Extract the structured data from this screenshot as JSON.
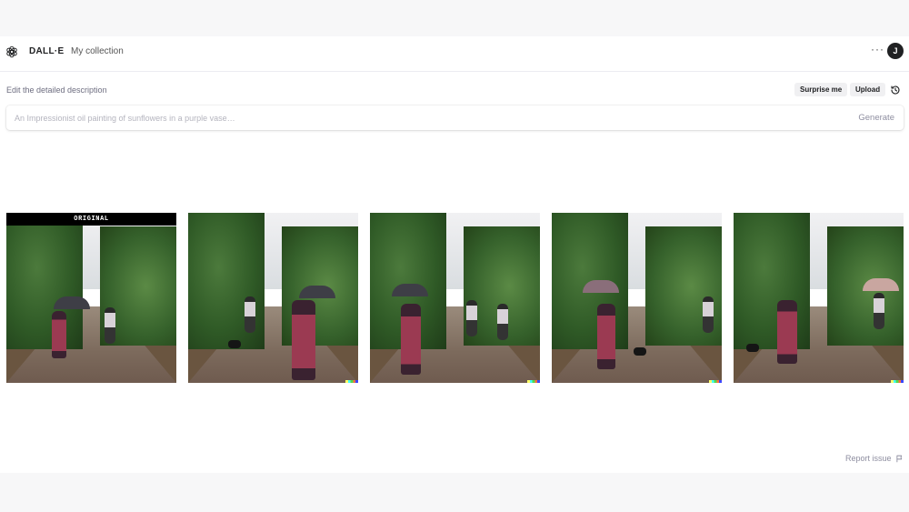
{
  "header": {
    "brand": "DALL·E",
    "collection_link": "My collection",
    "more_label": "···",
    "avatar_initial": "J"
  },
  "editor": {
    "description_label": "Edit the detailed description",
    "surprise_label": "Surprise me",
    "upload_label": "Upload",
    "prompt_placeholder": "An Impressionist oil painting of sunflowers in a purple vase…",
    "prompt_value": "",
    "generate_label": "Generate"
  },
  "gallery": {
    "original_badge": "ORIGINAL",
    "images": [
      {
        "kind": "original"
      },
      {
        "kind": "variation"
      },
      {
        "kind": "variation"
      },
      {
        "kind": "variation"
      },
      {
        "kind": "variation"
      }
    ]
  },
  "footer": {
    "report_label": "Report issue"
  },
  "colors": {
    "page_bg": "#f7f7f8",
    "panel_bg": "#ffffff",
    "text": "#202123",
    "muted": "#8e8ea0",
    "pill_bg": "#f0f0f2"
  },
  "icons": {
    "logo": "openai-logo-icon",
    "history": "history-icon",
    "flag": "flag-icon"
  }
}
